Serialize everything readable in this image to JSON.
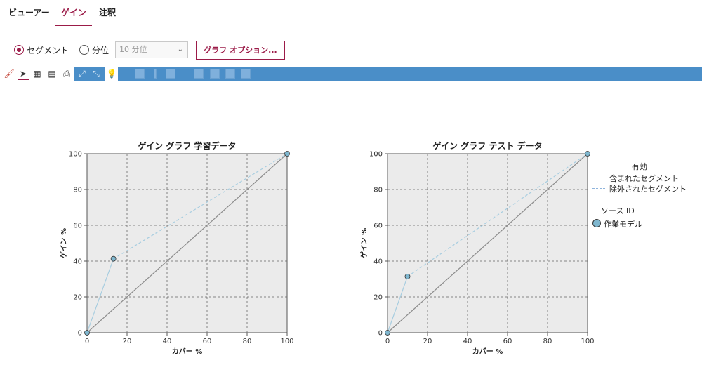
{
  "tabs": [
    {
      "label": "ビューアー",
      "active": false
    },
    {
      "label": "ゲイン",
      "active": true
    },
    {
      "label": "注釈",
      "active": false
    }
  ],
  "options": {
    "radio_segment": "セグメント",
    "radio_quantile": "分位",
    "quantile_select_value": "10 分位",
    "graph_options_button": "グラフ オプション..."
  },
  "toolbar": {
    "icons": [
      "paint-brush-icon",
      "pointer-icon",
      "copy-chart-icon",
      "copy-data-icon",
      "print-icon",
      "zoom-icon",
      "pan-icon",
      "tip-bulb-icon",
      "frame-icon",
      "line-icon",
      "wand-icon",
      "shape-icon",
      "drag-icon",
      "grid-icon",
      "rotate-icon"
    ]
  },
  "colors": {
    "accent": "#9b1b48",
    "toolbar_blue": "#4a8ec8",
    "included_line": "#a7cde0",
    "baseline": "#8c8c8c",
    "point_fill": "#7fb7cf",
    "plot_bg": "#ebebeb"
  },
  "chart_data": [
    {
      "type": "line",
      "title": "ゲイン グラフ 学習データ",
      "xlabel": "カバー %",
      "ylabel": "ゲイン %",
      "xlim": [
        0,
        100
      ],
      "ylim": [
        0,
        100
      ],
      "xticks": [
        "0",
        "20",
        "40",
        "60",
        "80",
        "100"
      ],
      "yticks": [
        "0",
        "20",
        "40",
        "60",
        "80",
        "100"
      ],
      "grid": true,
      "series": [
        {
          "name": "含まれたセグメント",
          "style": "solid",
          "x": [
            0,
            13.2
          ],
          "y": [
            0,
            41.3
          ]
        },
        {
          "name": "除外されたセグメント",
          "style": "dashed",
          "x": [
            13.2,
            100
          ],
          "y": [
            41.3,
            100
          ]
        },
        {
          "style": "baseline",
          "x": [
            0,
            100
          ],
          "y": [
            0,
            100
          ]
        }
      ],
      "points": [
        {
          "x": 0,
          "y": 0
        },
        {
          "x": 13.2,
          "y": 41.3
        },
        {
          "x": 100,
          "y": 100
        }
      ]
    },
    {
      "type": "line",
      "title": "ゲイン グラフ テスト データ",
      "xlabel": "カバー %",
      "ylabel": "ゲイン %",
      "xlim": [
        0,
        100
      ],
      "ylim": [
        0,
        100
      ],
      "xticks": [
        "0",
        "20",
        "40",
        "60",
        "80",
        "100"
      ],
      "yticks": [
        "0",
        "20",
        "40",
        "60",
        "80",
        "100"
      ],
      "grid": true,
      "series": [
        {
          "name": "含まれたセグメント",
          "style": "solid",
          "x": [
            0,
            10
          ],
          "y": [
            0,
            31.4
          ]
        },
        {
          "name": "除外されたセグメント",
          "style": "dashed",
          "x": [
            10,
            100
          ],
          "y": [
            31.4,
            100
          ]
        },
        {
          "style": "baseline",
          "x": [
            0,
            100
          ],
          "y": [
            0,
            100
          ]
        }
      ],
      "points": [
        {
          "x": 0,
          "y": 0
        },
        {
          "x": 10,
          "y": 31.4
        },
        {
          "x": 100,
          "y": 100
        }
      ]
    }
  ],
  "legend": {
    "title_valid": "有効",
    "included": "含まれたセグメント",
    "excluded": "除外されたセグメント",
    "title_source": "ソース ID",
    "source_item": "作業モデル"
  }
}
